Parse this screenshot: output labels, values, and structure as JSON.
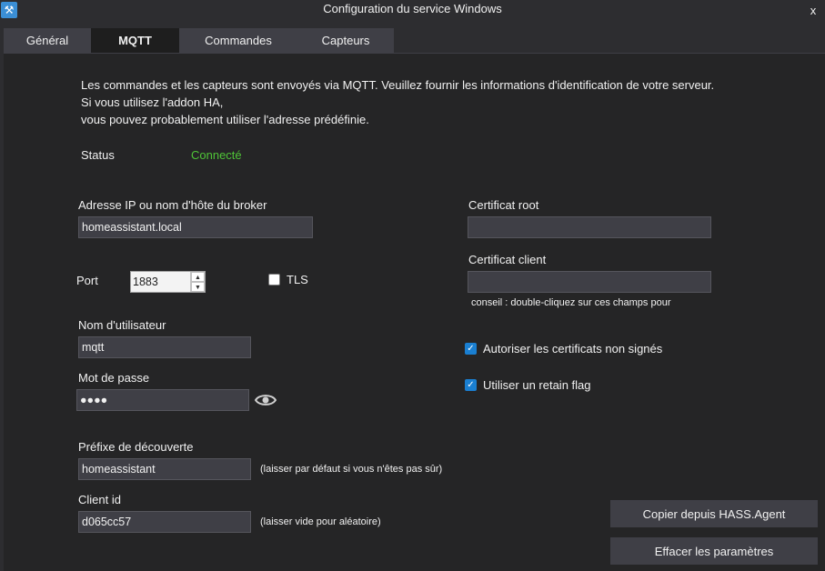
{
  "window": {
    "title": "Configuration du service Windows",
    "app_icon": "hass-agent-icon",
    "close_glyph": "x"
  },
  "tabs": [
    {
      "label": "Général",
      "active": false
    },
    {
      "label": "MQTT",
      "active": true
    },
    {
      "label": "Commandes",
      "active": false
    },
    {
      "label": "Capteurs",
      "active": false
    }
  ],
  "intro": {
    "line1": "Les commandes et les capteurs sont envoyés via MQTT. Veuillez fournir les informations d'identification de votre serveur.",
    "line2": "Si vous utilisez l'addon HA,",
    "line3": "vous pouvez probablement utiliser l'adresse prédéfinie."
  },
  "status": {
    "label": "Status",
    "value": "Connecté",
    "color": "#4fc437"
  },
  "broker": {
    "label": "Adresse IP ou nom d'hôte du broker",
    "value": "homeassistant.local"
  },
  "port": {
    "label": "Port",
    "value": "1883"
  },
  "tls": {
    "label": "TLS",
    "checked": false
  },
  "username": {
    "label": "Nom d'utilisateur",
    "value": "mqtt"
  },
  "password": {
    "label": "Mot de passe",
    "value": "●●●●",
    "toggle_icon": "eye-icon"
  },
  "discovery_prefix": {
    "label": "Préfixe de découverte",
    "value": "homeassistant",
    "hint": "(laisser par défaut si vous n'êtes pas sûr)"
  },
  "client_id": {
    "label": "Client id",
    "value": "d065cc57",
    "hint": "(laisser vide pour aléatoire)"
  },
  "root_cert": {
    "label": "Certificat root",
    "value": ""
  },
  "client_cert": {
    "label": "Certificat client",
    "value": "",
    "hint": "conseil : double-cliquez sur ces champs pour"
  },
  "allow_untrusted": {
    "label": "Autoriser les certificats non signés",
    "checked": true
  },
  "retain_flag": {
    "label": "Utiliser un retain flag",
    "checked": true
  },
  "buttons": {
    "copy": "Copier depuis HASS.Agent",
    "clear": "Effacer les paramètres"
  },
  "colors": {
    "background": "#252526",
    "chrome": "#2d2d30",
    "accent": "#1a7fd1",
    "field": "#3f3f46"
  }
}
